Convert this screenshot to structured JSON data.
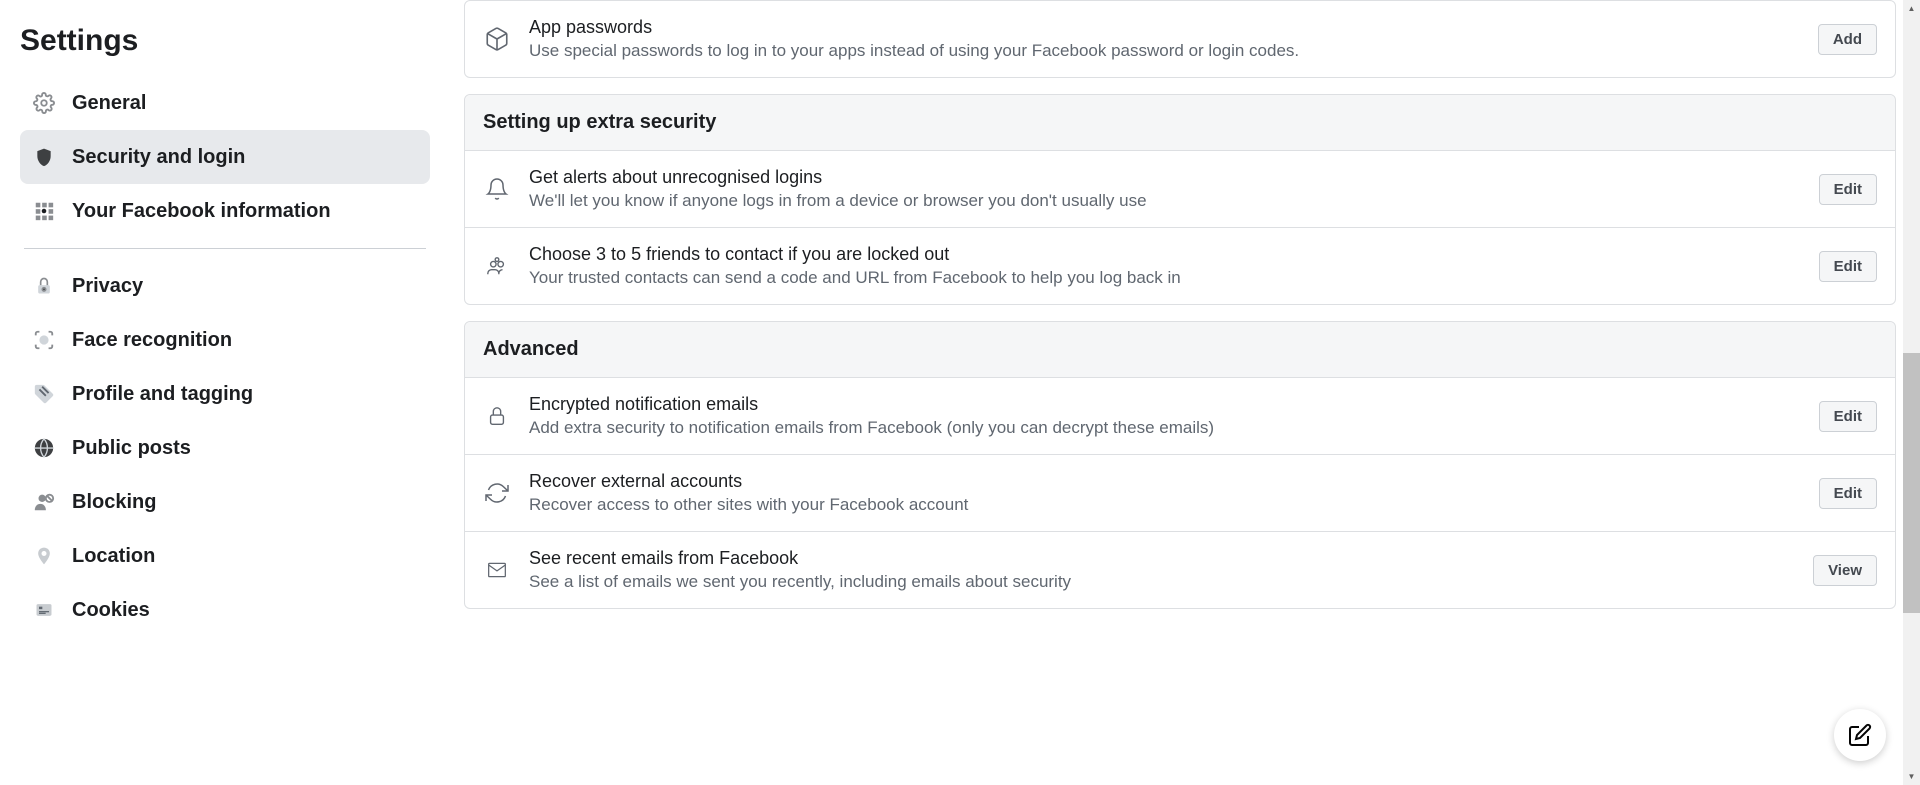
{
  "page_title": "Settings",
  "sidebar": {
    "group1": [
      {
        "label": "General",
        "icon": "gear"
      },
      {
        "label": "Security and login",
        "icon": "shield",
        "selected": true
      },
      {
        "label": "Your Facebook information",
        "icon": "grid"
      }
    ],
    "group2": [
      {
        "label": "Privacy",
        "icon": "lock"
      },
      {
        "label": "Face recognition",
        "icon": "face"
      },
      {
        "label": "Profile and tagging",
        "icon": "tag"
      },
      {
        "label": "Public posts",
        "icon": "globe"
      },
      {
        "label": "Blocking",
        "icon": "block"
      },
      {
        "label": "Location",
        "icon": "pin"
      },
      {
        "label": "Cookies",
        "icon": "card"
      }
    ]
  },
  "main": {
    "app_passwords": {
      "title": "App passwords",
      "desc": "Use special passwords to log in to your apps instead of using your Facebook password or login codes.",
      "btn": "Add"
    },
    "extra_security": {
      "header": "Setting up extra security",
      "rows": [
        {
          "title": "Get alerts about unrecognised logins",
          "desc": "We'll let you know if anyone logs in from a device or browser you don't usually use",
          "btn": "Edit",
          "icon": "bell"
        },
        {
          "title": "Choose 3 to 5 friends to contact if you are locked out",
          "desc": "Your trusted contacts can send a code and URL from Facebook to help you log back in",
          "btn": "Edit",
          "icon": "people"
        }
      ]
    },
    "advanced": {
      "header": "Advanced",
      "rows": [
        {
          "title": "Encrypted notification emails",
          "desc": "Add extra security to notification emails from Facebook (only you can decrypt these emails)",
          "btn": "Edit",
          "icon": "lock"
        },
        {
          "title": "Recover external accounts",
          "desc": "Recover access to other sites with your Facebook account",
          "btn": "Edit",
          "icon": "refresh"
        },
        {
          "title": "See recent emails from Facebook",
          "desc": "See a list of emails we sent you recently, including emails about security",
          "btn": "View",
          "icon": "envelope"
        }
      ]
    }
  }
}
